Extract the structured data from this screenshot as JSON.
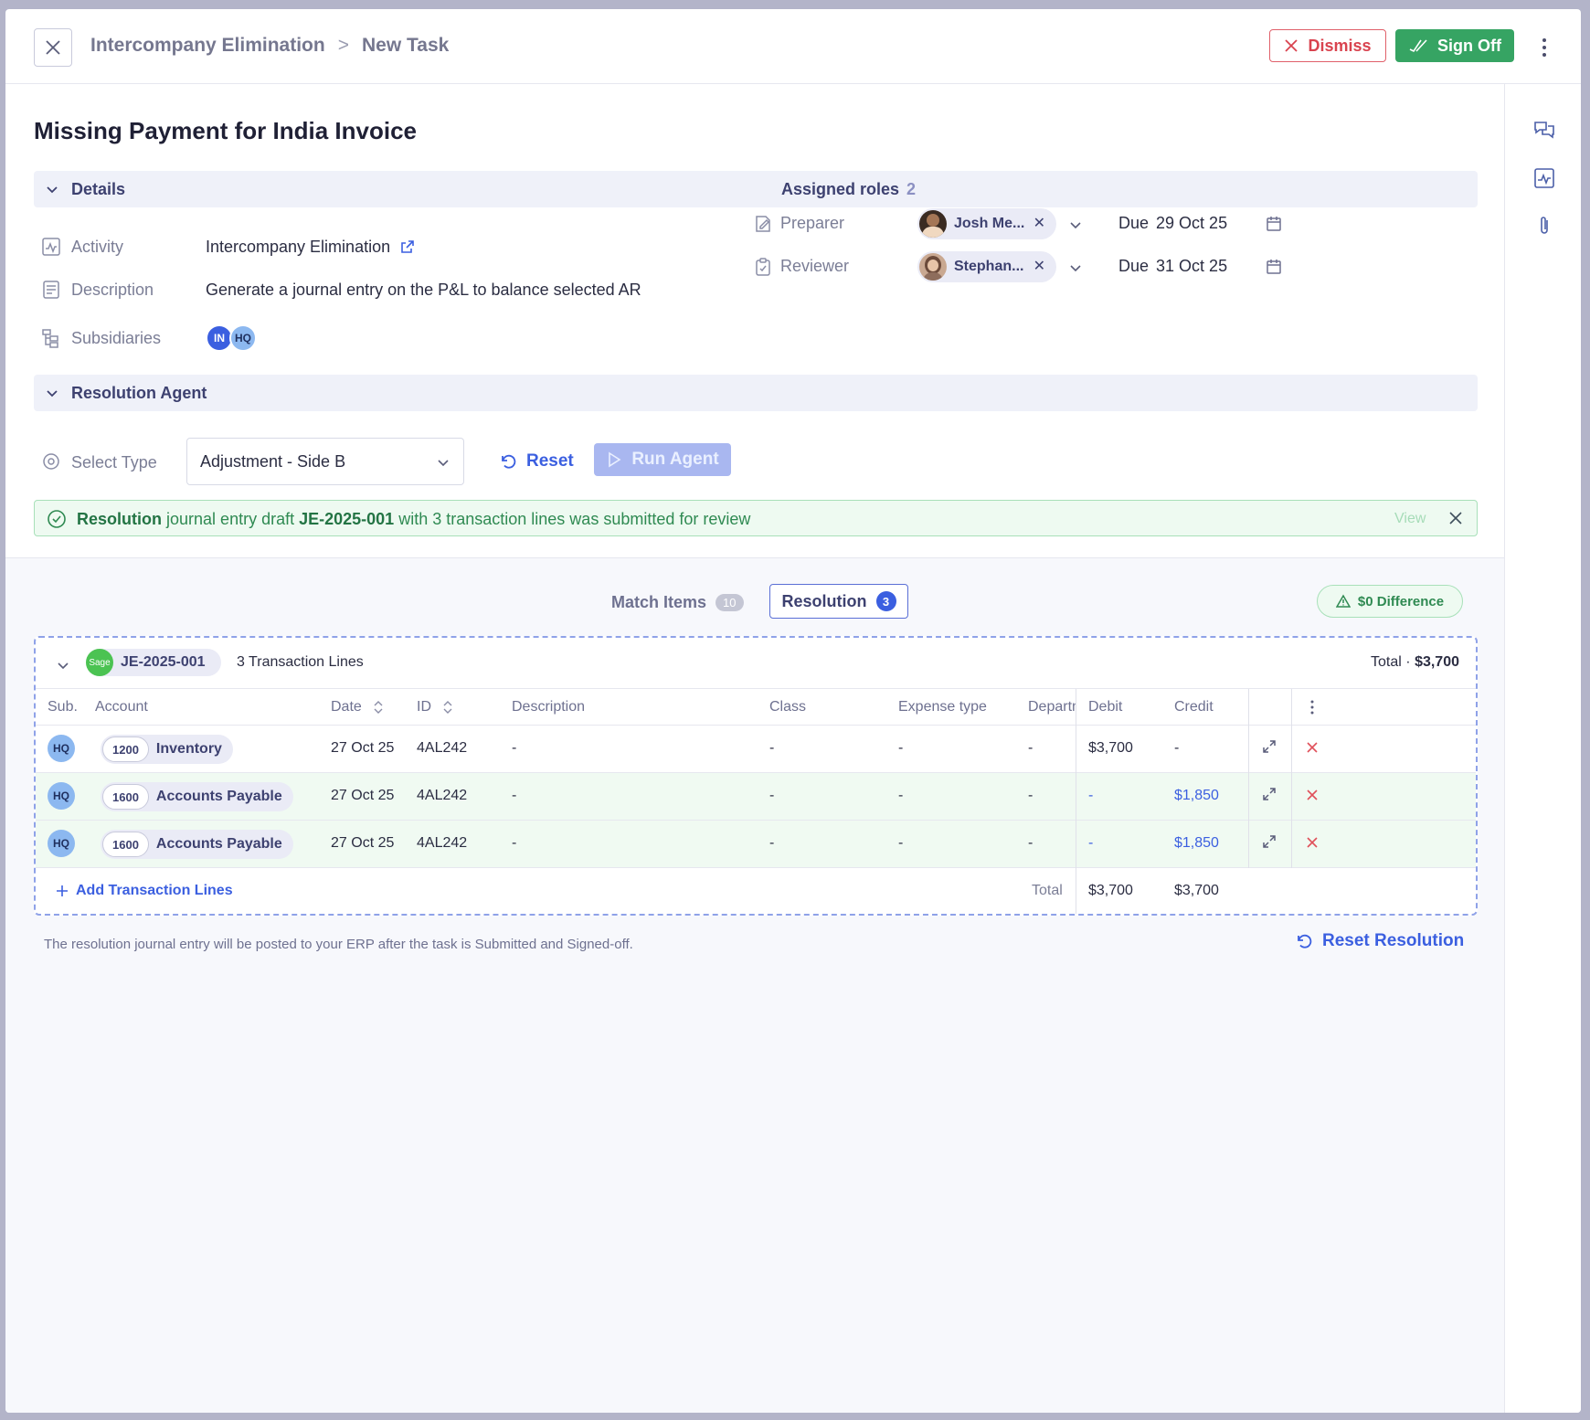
{
  "header": {
    "breadcrumb_parent": "Intercompany Elimination",
    "breadcrumb_separator": ">",
    "breadcrumb_current": "New Task",
    "dismiss_label": "Dismiss",
    "signoff_label": "Sign Off"
  },
  "task": {
    "title": "Missing Payment for India Invoice"
  },
  "details": {
    "section_label": "Details",
    "assigned_roles_label": "Assigned roles",
    "assigned_roles_count": "2",
    "activity_label": "Activity",
    "activity_value": "Intercompany Elimination",
    "description_label": "Description",
    "description_value": "Generate a journal entry on the P&L to balance selected AR",
    "subsidiaries_label": "Subsidiaries",
    "subsidiaries": [
      {
        "code": "IN",
        "color": "#3b5fe0"
      },
      {
        "code": "HQ",
        "color": "#8cb8f0"
      }
    ],
    "roles": [
      {
        "label": "Preparer",
        "person": "Josh Me...",
        "due_label": "Due",
        "due_date": "29 Oct 25"
      },
      {
        "label": "Reviewer",
        "person": "Stephan...",
        "due_label": "Due",
        "due_date": "31 Oct 25"
      }
    ]
  },
  "agent": {
    "section_label": "Resolution Agent",
    "select_type_label": "Select Type",
    "select_type_value": "Adjustment - Side B",
    "reset_label": "Reset",
    "run_label": "Run Agent"
  },
  "banner": {
    "lead": "Resolution",
    "mid1": "journal entry draft",
    "je_id": "JE-2025-001",
    "mid2": "with 3 transaction lines was submitted for review",
    "view_label": "View"
  },
  "tabs": {
    "match_label": "Match Items",
    "match_count": "10",
    "resolution_label": "Resolution",
    "resolution_count": "3",
    "difference_label": "$0 Difference"
  },
  "journal": {
    "logo_text": "Sage",
    "id": "JE-2025-001",
    "lines_label": "3 Transaction Lines",
    "total_label": "Total",
    "total_sep": "·",
    "total_value": "$3,700",
    "columns": {
      "sub": "Sub.",
      "account": "Account",
      "date": "Date",
      "id": "ID",
      "description": "Description",
      "class": "Class",
      "expense_type": "Expense type",
      "department": "Departm",
      "debit": "Debit",
      "credit": "Credit"
    },
    "rows": [
      {
        "sub": "HQ",
        "acct_no": "1200",
        "acct_name": "Inventory",
        "date": "27 Oct 25",
        "id": "4AL242",
        "description": "-",
        "class": "-",
        "expense_type": "-",
        "department": "-",
        "debit": "$3,700",
        "credit": "-"
      },
      {
        "sub": "HQ",
        "acct_no": "1600",
        "acct_name": "Accounts Payable",
        "date": "27 Oct 25",
        "id": "4AL242",
        "description": "-",
        "class": "-",
        "expense_type": "-",
        "department": "-",
        "debit": "-",
        "credit": "$1,850"
      },
      {
        "sub": "HQ",
        "acct_no": "1600",
        "acct_name": "Accounts Payable",
        "date": "27 Oct 25",
        "id": "4AL242",
        "description": "-",
        "class": "-",
        "expense_type": "-",
        "department": "-",
        "debit": "-",
        "credit": "$1,850"
      }
    ],
    "add_lines_label": "Add Transaction Lines",
    "footer_total_label": "Total",
    "footer_debit": "$3,700",
    "footer_credit": "$3,700"
  },
  "footer": {
    "note": "The resolution journal entry will be posted to your ERP after the task is Submitted and Signed-off.",
    "reset_resolution_label": "Reset Resolution"
  }
}
